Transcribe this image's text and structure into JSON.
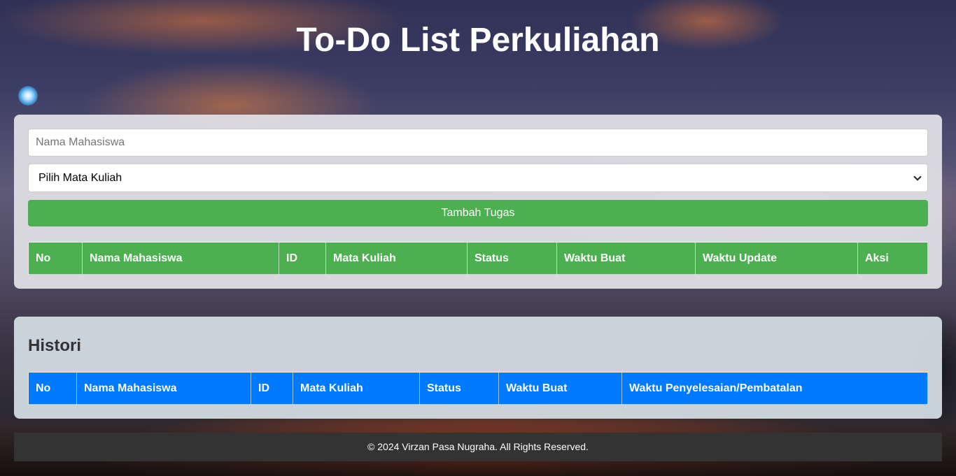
{
  "page": {
    "title": "To-Do List Perkuliahan"
  },
  "form": {
    "name_placeholder": "Nama Mahasiswa",
    "course_select_value": "Pilih Mata Kuliah",
    "add_button_label": "Tambah Tugas"
  },
  "task_table": {
    "headers": [
      "No",
      "Nama Mahasiswa",
      "ID",
      "Mata Kuliah",
      "Status",
      "Waktu Buat",
      "Waktu Update",
      "Aksi"
    ]
  },
  "history": {
    "title": "Histori",
    "headers": [
      "No",
      "Nama Mahasiswa",
      "ID",
      "Mata Kuliah",
      "Status",
      "Waktu Buat",
      "Waktu Penyelesaian/Pembatalan"
    ]
  },
  "footer": {
    "text": "© 2024 Virzan Pasa Nugraha. All Rights Reserved."
  },
  "icons": {
    "orb": "glowing-orb-icon",
    "dropdown": "chevron-down-icon"
  },
  "colors": {
    "primary_green": "#4caf50",
    "history_blue": "#007bff",
    "footer_bg": "#333333"
  }
}
